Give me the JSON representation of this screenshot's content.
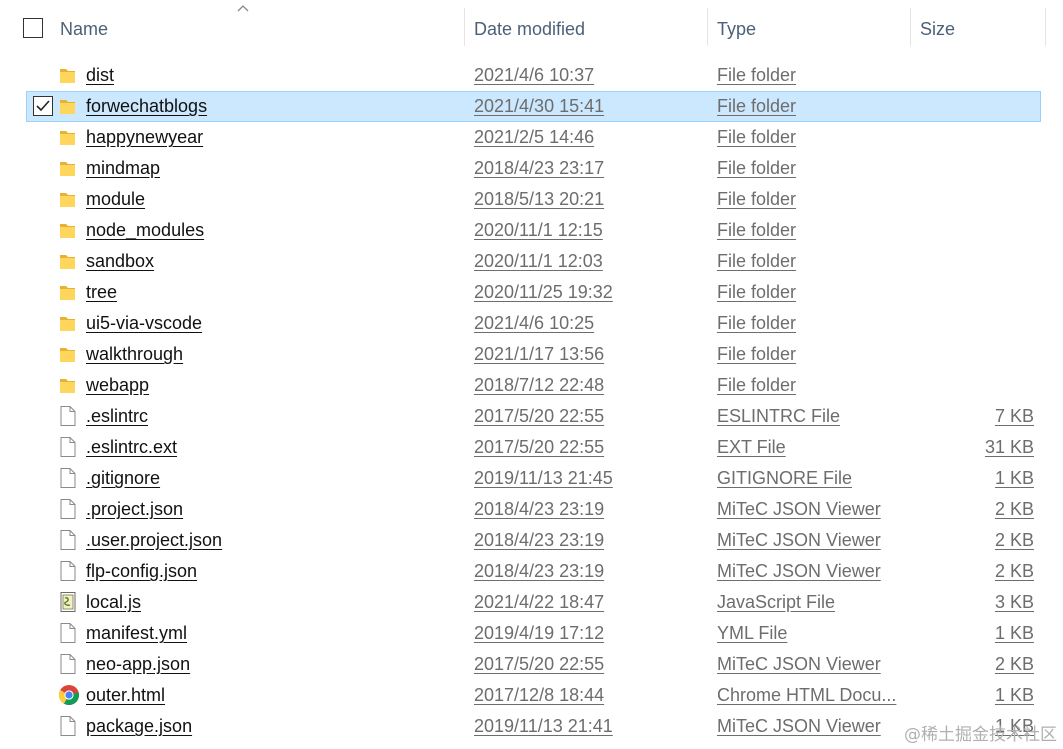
{
  "header": {
    "name": "Name",
    "date_modified": "Date modified",
    "type": "Type",
    "size": "Size"
  },
  "files": [
    {
      "name": "dist",
      "date": "2021/4/6 10:37",
      "type": "File folder",
      "size": "",
      "icon": "folder-icon",
      "selected": false
    },
    {
      "name": "forwechatblogs",
      "date": "2021/4/30 15:41",
      "type": "File folder",
      "size": "",
      "icon": "folder-icon",
      "selected": true
    },
    {
      "name": "happynewyear",
      "date": "2021/2/5 14:46",
      "type": "File folder",
      "size": "",
      "icon": "folder-icon",
      "selected": false
    },
    {
      "name": "mindmap",
      "date": "2018/4/23 23:17",
      "type": "File folder",
      "size": "",
      "icon": "folder-icon",
      "selected": false
    },
    {
      "name": "module",
      "date": "2018/5/13 20:21",
      "type": "File folder",
      "size": "",
      "icon": "folder-icon",
      "selected": false
    },
    {
      "name": "node_modules",
      "date": "2020/11/1 12:15",
      "type": "File folder",
      "size": "",
      "icon": "folder-icon",
      "selected": false
    },
    {
      "name": "sandbox",
      "date": "2020/11/1 12:03",
      "type": "File folder",
      "size": "",
      "icon": "folder-icon",
      "selected": false
    },
    {
      "name": "tree",
      "date": "2020/11/25 19:32",
      "type": "File folder",
      "size": "",
      "icon": "folder-icon",
      "selected": false
    },
    {
      "name": "ui5-via-vscode",
      "date": "2021/4/6 10:25",
      "type": "File folder",
      "size": "",
      "icon": "folder-icon",
      "selected": false
    },
    {
      "name": "walkthrough",
      "date": "2021/1/17 13:56",
      "type": "File folder",
      "size": "",
      "icon": "folder-icon",
      "selected": false
    },
    {
      "name": "webapp",
      "date": "2018/7/12 22:48",
      "type": "File folder",
      "size": "",
      "icon": "folder-icon",
      "selected": false
    },
    {
      "name": ".eslintrc",
      "date": "2017/5/20 22:55",
      "type": "ESLINTRC File",
      "size": "7 KB",
      "icon": "file-icon",
      "selected": false
    },
    {
      "name": ".eslintrc.ext",
      "date": "2017/5/20 22:55",
      "type": "EXT File",
      "size": "31 KB",
      "icon": "file-icon",
      "selected": false
    },
    {
      "name": ".gitignore",
      "date": "2019/11/13 21:45",
      "type": "GITIGNORE File",
      "size": "1 KB",
      "icon": "file-icon",
      "selected": false
    },
    {
      "name": ".project.json",
      "date": "2018/4/23 23:19",
      "type": "MiTeC JSON Viewer",
      "size": "2 KB",
      "icon": "file-icon",
      "selected": false
    },
    {
      "name": ".user.project.json",
      "date": "2018/4/23 23:19",
      "type": "MiTeC JSON Viewer",
      "size": "2 KB",
      "icon": "file-icon",
      "selected": false
    },
    {
      "name": "flp-config.json",
      "date": "2018/4/23 23:19",
      "type": "MiTeC JSON Viewer",
      "size": "2 KB",
      "icon": "file-icon",
      "selected": false
    },
    {
      "name": "local.js",
      "date": "2021/4/22 18:47",
      "type": "JavaScript File",
      "size": "3 KB",
      "icon": "script-file-icon",
      "selected": false
    },
    {
      "name": "manifest.yml",
      "date": "2019/4/19 17:12",
      "type": "YML File",
      "size": "1 KB",
      "icon": "file-icon",
      "selected": false
    },
    {
      "name": "neo-app.json",
      "date": "2017/5/20 22:55",
      "type": "MiTeC JSON Viewer",
      "size": "2 KB",
      "icon": "file-icon",
      "selected": false
    },
    {
      "name": "outer.html",
      "date": "2017/12/8 18:44",
      "type": "Chrome HTML Docu...",
      "size": "1 KB",
      "icon": "chrome-icon",
      "selected": false
    },
    {
      "name": "package.json",
      "date": "2019/11/13 21:41",
      "type": "MiTeC JSON Viewer",
      "size": "1 KB",
      "icon": "file-icon",
      "selected": false
    }
  ],
  "watermark": "@稀土掘金技术社区",
  "colors": {
    "selection_bg": "#cce8ff",
    "selection_border": "#99d1ff",
    "header_text": "#4c607a",
    "folder": "#f5c542"
  }
}
